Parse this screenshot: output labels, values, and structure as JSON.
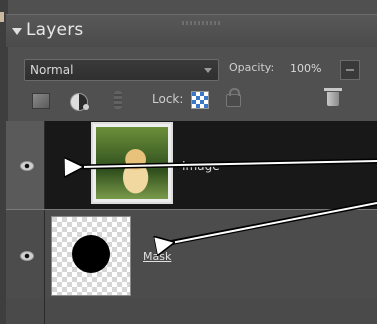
{
  "panel": {
    "title": "Layers"
  },
  "blend_mode": {
    "selected": "Normal"
  },
  "opacity": {
    "label": "Opacity:",
    "value": "100%"
  },
  "lock": {
    "label": "Lock:"
  },
  "layers": [
    {
      "name": "Image",
      "visible": true
    },
    {
      "name": "Mask",
      "visible": true
    }
  ],
  "icons": {
    "visibility": "eye-icon",
    "new_layer": "new-layer-icon",
    "adjustment": "adjustment-layer-icon",
    "link": "link-icon",
    "lock_transparent": "lock-transparent-icon",
    "lock_all": "lock-icon",
    "delete": "trash-icon"
  },
  "colors": {
    "panel_bg": "#505050",
    "selected_row": "#181818",
    "accent_lock": "#3c78c8"
  }
}
